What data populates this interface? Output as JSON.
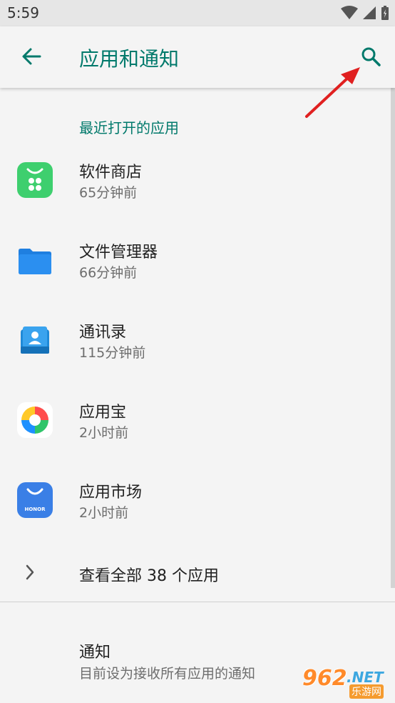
{
  "status_bar": {
    "time": "5:59"
  },
  "app_bar": {
    "title": "应用和通知"
  },
  "section": {
    "recent_header": "最近打开的应用"
  },
  "apps": [
    {
      "name": "软件商店",
      "sub": "65分钟前",
      "icon": "software-store-icon",
      "color": "#3ecf6e"
    },
    {
      "name": "文件管理器",
      "sub": "66分钟前",
      "icon": "file-manager-icon",
      "color": "#1f7fe0"
    },
    {
      "name": "通讯录",
      "sub": "115分钟前",
      "icon": "contacts-icon",
      "color": "#1f8ad8"
    },
    {
      "name": "应用宝",
      "sub": "2小时前",
      "icon": "yingyongbao-icon",
      "color": "#ffffff"
    },
    {
      "name": "应用市场",
      "sub": "2小时前",
      "icon": "app-market-icon",
      "color": "#3a7fe6",
      "icon_text": "HONOR"
    }
  ],
  "see_all": {
    "label": "查看全部 38 个应用"
  },
  "notifications": {
    "title": "通知",
    "sub": "目前设为接收所有应用的通知"
  },
  "watermark": {
    "num": "962",
    "net": ".NET",
    "cn": "乐游网"
  },
  "colors": {
    "accent": "#00796b",
    "annotation_arrow": "#e02020"
  }
}
